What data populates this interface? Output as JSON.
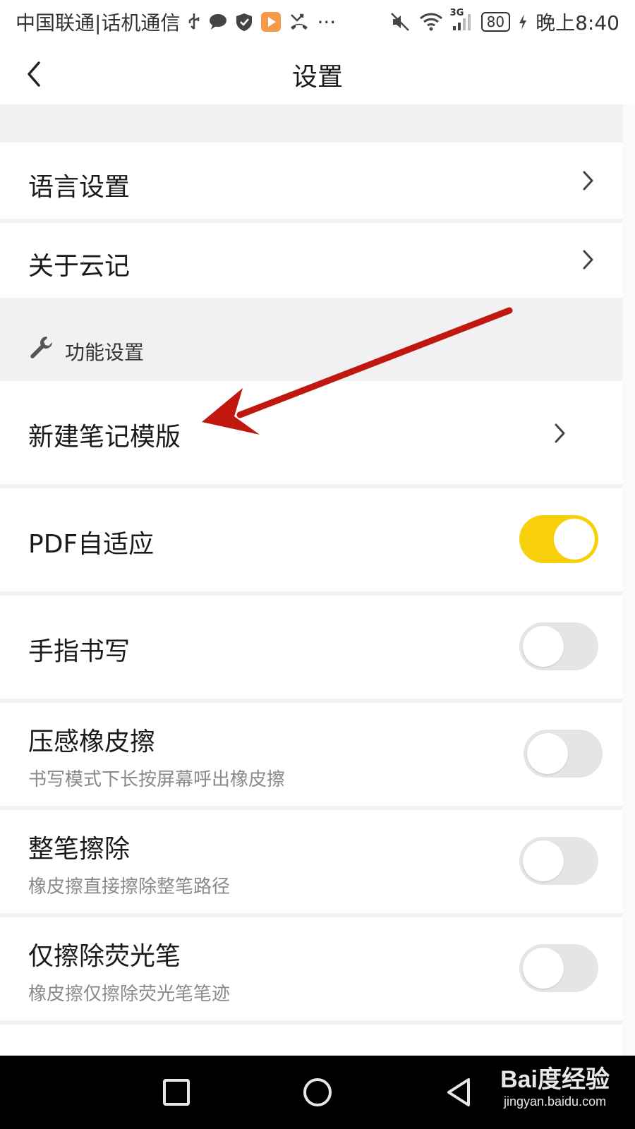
{
  "status_bar": {
    "carrier": "中国联通|话机通信",
    "battery": "80",
    "time": "晚上8:40",
    "network": "3G",
    "more": "···"
  },
  "header": {
    "title": "设置",
    "back_icon": "chevron-left-icon"
  },
  "settings": {
    "language": {
      "label": "语言设置"
    },
    "about": {
      "label": "关于云记"
    },
    "section": {
      "label": "功能设置",
      "icon": "wrench-icon"
    },
    "template": {
      "label": "新建笔记模版"
    },
    "pdf_fit": {
      "label": "PDF自适应",
      "enabled": true
    },
    "finger_writing": {
      "label": "手指书写",
      "enabled": false
    },
    "pressure_eraser": {
      "label": "压感橡皮擦",
      "sub": "书写模式下长按屏幕呼出橡皮擦",
      "enabled": false
    },
    "stroke_erase": {
      "label": "整笔擦除",
      "sub": "橡皮擦直接擦除整笔路径",
      "enabled": false
    },
    "highlighter_erase": {
      "label": "仅擦除荧光笔",
      "sub": "橡皮擦仅擦除荧光笔笔迹",
      "enabled": false
    }
  },
  "nav_bar": {
    "recent_icon": "square-icon",
    "home_icon": "circle-icon",
    "back_icon": "triangle-back-icon"
  },
  "watermark": {
    "main": "Bai度经验",
    "sub": "jingyan.baidu.com"
  },
  "colors": {
    "toggle_on": "#f7cf0a",
    "toggle_off": "#e5e5e5",
    "section_bg": "#f1f1f4",
    "annotation_arrow": "#c0170f"
  }
}
